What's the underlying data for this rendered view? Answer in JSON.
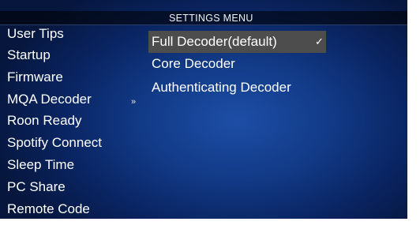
{
  "header": {
    "title": "SETTINGS MENU"
  },
  "left_menu": {
    "items": [
      {
        "label": "User Tips"
      },
      {
        "label": "Startup"
      },
      {
        "label": "Firmware"
      },
      {
        "label": "MQA Decoder"
      },
      {
        "label": "Roon Ready"
      },
      {
        "label": "Spotify Connect"
      },
      {
        "label": "Sleep Time"
      },
      {
        "label": "PC Share"
      },
      {
        "label": "Remote Code"
      }
    ],
    "active_item": "MQA Decoder",
    "expand_indicator": "»"
  },
  "submenu": {
    "items": [
      {
        "label": "Full Decoder(default)",
        "selected": true
      },
      {
        "label": "Core Decoder",
        "selected": false
      },
      {
        "label": "Authenticating Decoder",
        "selected": false
      }
    ],
    "selected_mark": "✓"
  },
  "colors": {
    "background_center": "#1d4ea6",
    "background_edge": "#06163c",
    "title_bar": "#000000",
    "selection_highlight": "#4d4d4d",
    "text": "#ffffff"
  }
}
